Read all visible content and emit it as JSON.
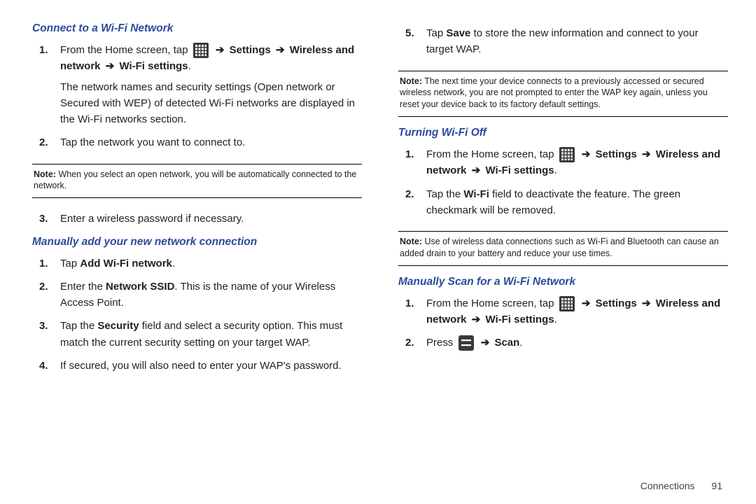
{
  "left": {
    "sec1_title": "Connect to a Wi-Fi Network",
    "sec1_steps": {
      "s1_pre": "From the Home screen, tap ",
      "s1_path_settings": "Settings",
      "s1_path_wireless": "Wireless and network",
      "s1_path_wifi": "Wi-Fi settings",
      "s1_after": "The network names and security settings (Open network or Secured with WEP) of detected Wi-Fi networks are displayed in the Wi-Fi networks section.",
      "s2": "Tap the network you want to connect to."
    },
    "note1_lead": "Note:",
    "note1_body": "When you select an open network, you will be automatically connected to the network.",
    "sec1b_s3": "Enter a wireless password if necessary.",
    "sec2_title": "Manually add your new network connection",
    "sec2_steps": {
      "s1_pre": "Tap ",
      "s1_b": "Add Wi-Fi network",
      "s2_pre": " Enter the ",
      "s2_b": "Network SSID",
      "s2_post": ". This is the name of your Wireless Access Point.",
      "s3_pre": "Tap the ",
      "s3_b": "Security",
      "s3_post": " field and select a security option. This must match the current security setting on your target WAP.",
      "s4": " If secured, you will also need to enter your WAP's password."
    }
  },
  "right": {
    "sec2_s5_pre": "Tap ",
    "sec2_s5_b": "Save",
    "sec2_s5_post": " to store the new information and connect to your target WAP.",
    "note2_lead": "Note:",
    "note2_body": "The next time your device connects to a previously accessed or secured wireless network, you are not prompted to enter the WAP key again, unless you reset your device back to its factory default settings.",
    "sec3_title": "Turning Wi-Fi Off",
    "sec3_steps": {
      "s1_pre": "From the Home screen, tap ",
      "s1_path_settings": "Settings",
      "s1_path_wireless": "Wireless and network",
      "s1_path_wifi": "Wi-Fi settings",
      "s2_pre": "Tap the ",
      "s2_b": "Wi-Fi",
      "s2_post": " field to deactivate the feature. The green checkmark will be removed."
    },
    "note3_lead": "Note:",
    "note3_body": "Use of wireless data connections such as Wi-Fi and Bluetooth can cause an added drain to your battery and reduce your use times.",
    "sec4_title": "Manually Scan for a Wi-Fi Network",
    "sec4_steps": {
      "s1_pre": "From the Home screen, tap ",
      "s1_path_settings": "Settings",
      "s1_path_wireless": "Wireless and network",
      "s1_path_wifi": "Wi-Fi settings",
      "s2_pre": "Press ",
      "s2_b": "Scan"
    }
  },
  "footer": {
    "section": "Connections",
    "page": "91"
  },
  "glyphs": {
    "arrow": "➔"
  }
}
